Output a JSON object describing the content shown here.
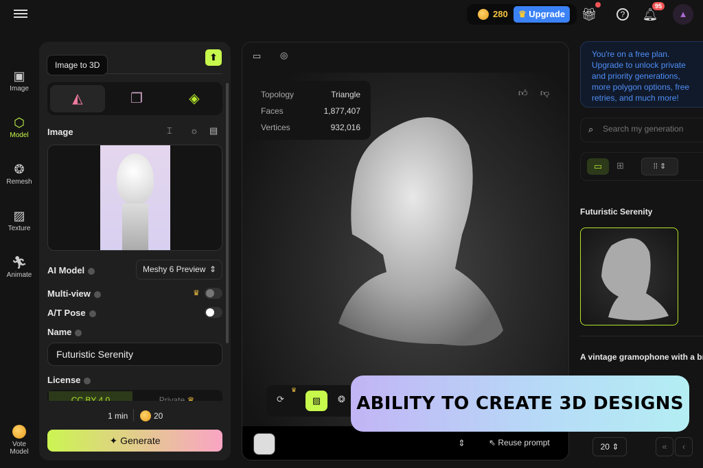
{
  "topbar": {
    "credits": "280",
    "upgrade": "Upgrade",
    "notifications": "95"
  },
  "rail": [
    {
      "label": "Image",
      "icon": "image-ai-icon"
    },
    {
      "label": "Model",
      "icon": "cube-icon"
    },
    {
      "label": "Remesh",
      "icon": "remesh-icon"
    },
    {
      "label": "Texture",
      "icon": "texture-icon"
    },
    {
      "label": "Animate",
      "icon": "run-icon"
    }
  ],
  "vote": {
    "line1": "Vote",
    "line2": "Model"
  },
  "panel": {
    "tooltip": "Image to 3D",
    "image_label": "Image",
    "ai_model_label": "AI Model",
    "ai_model_value": "Meshy 6 Preview",
    "multiview_label": "Multi-view",
    "multiview_on": false,
    "pose_label": "A/T Pose",
    "pose_on": false,
    "name_label": "Name",
    "name_value": "Futuristic Serenity",
    "license_label": "License",
    "license_options": [
      "CC BY 4.0",
      "Private"
    ],
    "time": "1 min",
    "cost": "20",
    "generate": "Generate"
  },
  "viewer": {
    "stats": [
      {
        "k": "Topology",
        "v": "Triangle"
      },
      {
        "k": "Faces",
        "v": "1,877,407"
      },
      {
        "k": "Vertices",
        "v": "932,016"
      }
    ],
    "reuse": "Reuse prompt"
  },
  "right": {
    "notice": "You're on a free plan. Upgrade to unlock private and priority generations, more polygon options, free retries, and much more!",
    "search_placeholder": "Search my generation",
    "item1": "Futuristic Serenity",
    "item2": "A vintage gramophone with a bra",
    "page_size": "20"
  },
  "banner": "ABILITY TO CREATE 3D DESIGNS",
  "colors": {
    "accent": "#c7f94c",
    "blue": "#3b82f6"
  }
}
